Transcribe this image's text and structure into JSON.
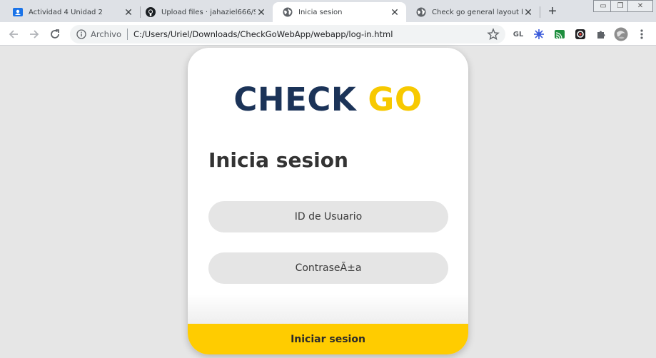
{
  "tabs": [
    {
      "title": "Actividad 4 Unidad 2",
      "icon": "google-classroom-icon",
      "active": false
    },
    {
      "title": "Upload files · jahaziel666/Sista",
      "icon": "github-icon",
      "active": false
    },
    {
      "title": "Inicia sesion",
      "icon": "globe-icon",
      "active": true
    },
    {
      "title": "Check go general layout buildi",
      "icon": "globe-icon",
      "active": false
    }
  ],
  "new_tab_label": "+",
  "window_controls": {
    "minimize": "▭",
    "restore": "❐",
    "close": "✕"
  },
  "toolbar": {
    "address": {
      "scheme_label": "Archivo",
      "url": "C:/Users/Uriel/Downloads/CheckGoWebApp/webapp/log-in.html"
    },
    "extensions": {
      "gl_label": "GL"
    }
  },
  "page": {
    "logo_check": "CHECK",
    "logo_go": "GO",
    "heading": "Inicia sesion",
    "user_id_placeholder": "ID de Usuario",
    "password_placeholder": "ContraseÃ±a",
    "submit_label": "Iniciar sesion"
  },
  "colors": {
    "brand_navy": "#1b3358",
    "brand_yellow": "#f7c900",
    "button_yellow": "#ffcc00",
    "field_gray": "#e5e5e5"
  }
}
